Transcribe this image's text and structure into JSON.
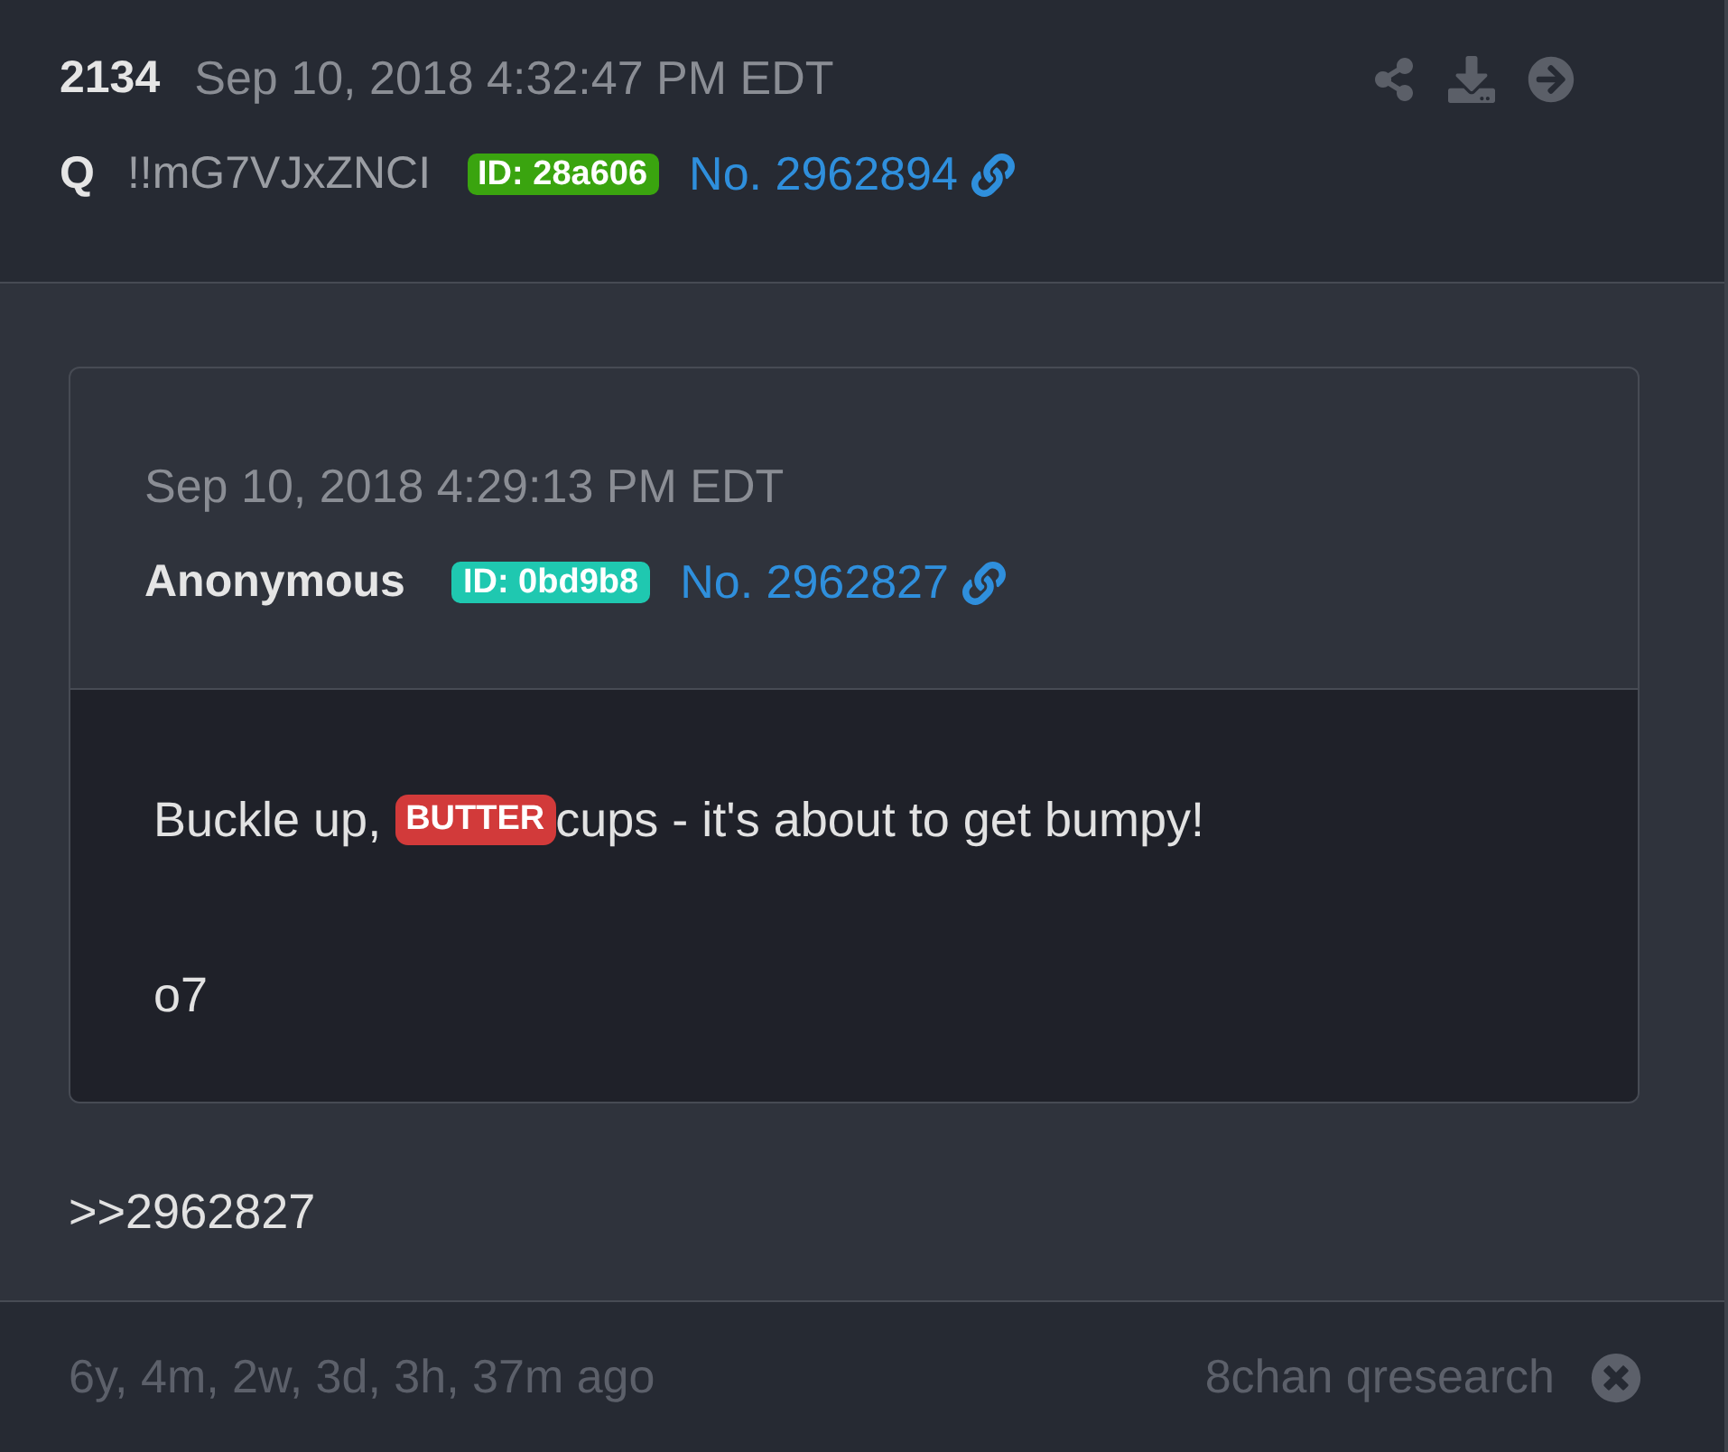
{
  "post": {
    "number": "2134",
    "timestamp": "Sep 10, 2018 4:32:47 PM EDT",
    "author": "Q",
    "tripcode": "!!mG7VJxZNCI",
    "id_badge": {
      "text": "ID: 28a606",
      "color": "#3aa40f"
    },
    "post_link": "No. 2962894"
  },
  "quoted_post": {
    "timestamp": "Sep 10, 2018 4:29:13 PM EDT",
    "author": "Anonymous",
    "id_badge": {
      "text": "ID: 0bd9b8",
      "color": "#1fc8b0"
    },
    "post_link": "No. 2962827",
    "body": [
      [
        {
          "kind": "text",
          "text": "Buckle up, "
        },
        {
          "kind": "badge",
          "text": "BUTTER"
        },
        {
          "kind": "text",
          "text": "cups - it's about to get bumpy!"
        }
      ],
      [
        {
          "kind": "text",
          "text": "o7"
        }
      ]
    ]
  },
  "reply": ">>2962827",
  "footer": {
    "age": "6y, 4m, 2w, 3d, 3h, 37m ago",
    "source": "8chan qresearch"
  }
}
